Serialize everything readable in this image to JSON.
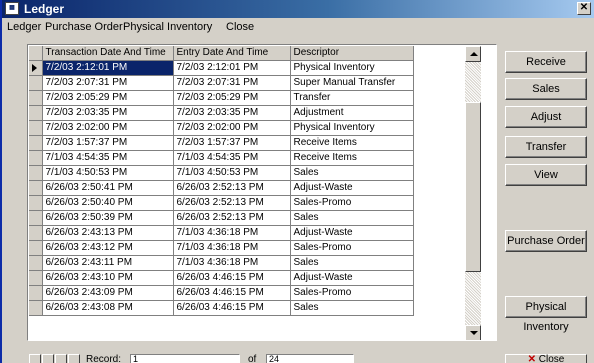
{
  "window": {
    "title": "Ledger",
    "icon": "ledger-app-icon",
    "close_glyph": "✕"
  },
  "menu": [
    "Ledger",
    "Purchase Order",
    "Physical Inventory",
    "Close"
  ],
  "grid": {
    "columns": [
      "Transaction Date And Time",
      "Entry Date And Time",
      "Descriptor"
    ],
    "selected_row": 0,
    "rows": [
      [
        "7/2/03 2:12:01 PM",
        "7/2/03 2:12:01 PM",
        "Physical Inventory"
      ],
      [
        "7/2/03 2:07:31 PM",
        "7/2/03 2:07:31 PM",
        "Super Manual Transfer"
      ],
      [
        "7/2/03 2:05:29 PM",
        "7/2/03 2:05:29 PM",
        "Transfer"
      ],
      [
        "7/2/03 2:03:35 PM",
        "7/2/03 2:03:35 PM",
        "Adjustment"
      ],
      [
        "7/2/03 2:02:00 PM",
        "7/2/03 2:02:00 PM",
        "Physical Inventory"
      ],
      [
        "7/2/03 1:57:37 PM",
        "7/2/03 1:57:37 PM",
        "Receive Items"
      ],
      [
        "7/1/03 4:54:35 PM",
        "7/1/03 4:54:35 PM",
        "Receive Items"
      ],
      [
        "7/1/03 4:50:53 PM",
        "7/1/03 4:50:53 PM",
        "Sales"
      ],
      [
        "6/26/03 2:50:41 PM",
        "6/26/03 2:52:13 PM",
        "Adjust-Waste"
      ],
      [
        "6/26/03 2:50:40 PM",
        "6/26/03 2:52:13 PM",
        "Sales-Promo"
      ],
      [
        "6/26/03 2:50:39 PM",
        "6/26/03 2:52:13 PM",
        "Sales"
      ],
      [
        "6/26/03 2:43:13 PM",
        "7/1/03 4:36:18 PM",
        "Adjust-Waste"
      ],
      [
        "6/26/03 2:43:12 PM",
        "7/1/03 4:36:18 PM",
        "Sales-Promo"
      ],
      [
        "6/26/03 2:43:11 PM",
        "7/1/03 4:36:18 PM",
        "Sales"
      ],
      [
        "6/26/03 2:43:10 PM",
        "6/26/03 4:46:15 PM",
        "Adjust-Waste"
      ],
      [
        "6/26/03 2:43:09 PM",
        "6/26/03 4:46:15 PM",
        "Sales-Promo"
      ],
      [
        "6/26/03 2:43:08 PM",
        "6/26/03 4:46:15 PM",
        "Sales"
      ]
    ]
  },
  "buttons": {
    "receive": "Receive",
    "sales": "Sales",
    "adjust": "Adjust",
    "transfer": "Transfer",
    "view": "View",
    "purchase_order": "Purchase Order",
    "physical_inventory": "Physical Inventory"
  },
  "footer": {
    "record_label": "Record:",
    "of_label": "of",
    "record_value": "1",
    "of_value": "24",
    "close_label": "Close",
    "close_glyph": "✕"
  },
  "colors": {
    "title_bar": "#0a246a",
    "selection": "#0a246a",
    "face": "#d4d0c8",
    "desktop": "#0d2ba8"
  }
}
